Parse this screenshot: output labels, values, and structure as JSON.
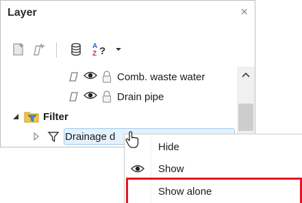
{
  "panel": {
    "title": "Layer",
    "close_glyph": "×"
  },
  "toolbar": {
    "buttons": [
      "new-layer-icon",
      "new-layer-copy-icon",
      "database-icon",
      "sort-az-icon",
      "dropdown-arrow-icon"
    ],
    "dropdown_glyph": "▾"
  },
  "tree": {
    "items": [
      {
        "label": "Comb. waste water",
        "icons": [
          "layer-page-icon",
          "eye-icon",
          "lock-icon"
        ]
      },
      {
        "label": "Drain pipe",
        "icons": [
          "layer-page-icon",
          "eye-icon",
          "lock-icon"
        ]
      },
      {
        "label": "Filter",
        "icons": [
          "collapse-triangle-icon",
          "folder-filter-icon"
        ]
      },
      {
        "label": "Drainage d",
        "icons": [
          "expand-triangle-icon",
          "funnel-icon"
        ],
        "selected": true
      }
    ]
  },
  "context_menu": {
    "items": [
      {
        "label": "Hide",
        "icon": ""
      },
      {
        "label": "Show",
        "icon": "eye-icon"
      },
      {
        "label": "Show alone",
        "icon": "",
        "highlighted": true
      }
    ]
  },
  "colors": {
    "highlight_border": "#e4141e",
    "selection_bg": "#e5f1fb",
    "selection_border": "#99c9ef"
  }
}
